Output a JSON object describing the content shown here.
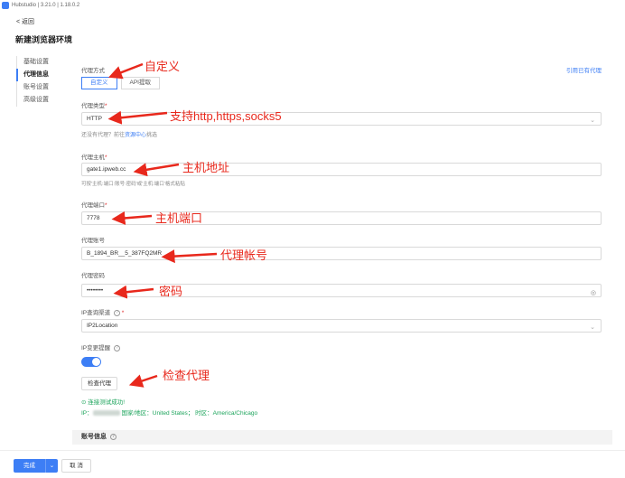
{
  "titlebar": {
    "text": "Hubstudio | 3.21.0 | 1.18.0.2"
  },
  "back": {
    "label": "< 返回"
  },
  "page": {
    "title": "新建浏览器环境"
  },
  "sidenav": {
    "items": [
      "基础设置",
      "代理信息",
      "账号设置",
      "高级设置"
    ]
  },
  "form": {
    "proxy_method": {
      "label": "代理方式",
      "options": [
        "自定义",
        "API提取"
      ],
      "selected": "自定义",
      "link": "引用已有代理"
    },
    "proxy_type": {
      "label": "代理类型",
      "required": "*",
      "value": "HTTP"
    },
    "no_proxy_hint": {
      "text": "还没有代理？前往",
      "link": "资源中心",
      "suffix": "挑选"
    },
    "host": {
      "label": "代理主机",
      "required": "*",
      "value": "gate1.ipweb.cc",
      "hint": "可按'主机:端口:账号:密码'或'主机:端口'格式粘贴"
    },
    "port": {
      "label": "代理端口",
      "required": "*",
      "value": "7778"
    },
    "account": {
      "label": "代理账号",
      "value": "B_1894_BR__5_387FQ2MR"
    },
    "password": {
      "label": "代理密码",
      "value": "••••••••"
    },
    "ip_channel": {
      "label": "IP查询渠道",
      "required": "*",
      "value": "IP2Location"
    },
    "ip_change": {
      "label": "IP变更提醒",
      "enabled": true
    },
    "check_button": "检查代理",
    "result": {
      "success": "连接测试成功!",
      "ip_label": "IP：",
      "country_label": "国家/地区：",
      "country": "United States",
      "timezone_label": "时区：",
      "timezone": "America/Chicago"
    }
  },
  "section2": {
    "title": "账号信息"
  },
  "footer": {
    "done": "完成",
    "cancel": "取 消"
  },
  "annotations": {
    "custom": "自定义",
    "protocols": "支持http,https,socks5",
    "host": "主机地址",
    "port": "主机端口",
    "account": "代理帐号",
    "password": "密码",
    "check": "检查代理"
  },
  "colors": {
    "accent": "#3d7ef5",
    "annotation": "#e8281c",
    "success": "#1aa35a"
  }
}
